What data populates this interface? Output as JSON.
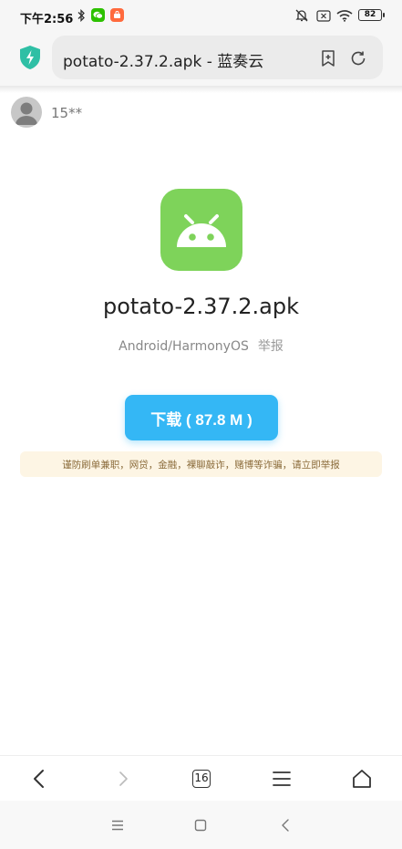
{
  "status_bar": {
    "time": "下午2:56",
    "battery": "82",
    "icons": [
      "bluetooth-icon",
      "wechat-icon",
      "orange-app-icon",
      "mute-icon",
      "sim-x-icon",
      "wifi-icon",
      "battery-icon"
    ]
  },
  "address_bar": {
    "url_text": "potato-2.37.2.apk - 蓝奏云",
    "icons": [
      "shield-icon",
      "bookmark-add-icon",
      "refresh-icon"
    ]
  },
  "user": {
    "name": "15**"
  },
  "app": {
    "file_name": "potato-2.37.2.apk",
    "platform": "Android/HarmonyOS",
    "report_label": "举报",
    "icon": "android-icon"
  },
  "download": {
    "label": "下载 ( 87.8 M )"
  },
  "warning": {
    "text": "谨防刷单兼职，网贷，金融，裸聊敲诈，赌博等诈骗，请立即举报"
  },
  "toolbar": {
    "tabs_count": "16",
    "icons": [
      "back-icon",
      "forward-icon",
      "tabs-icon",
      "menu-icon",
      "home-icon"
    ]
  },
  "system_nav": {
    "icons": [
      "recents-icon",
      "home-square-icon",
      "back-triangle-icon"
    ]
  },
  "colors": {
    "accent": "#34b7f5",
    "app_icon": "#7ed35a",
    "warning_bg": "#fdf5e4",
    "warning_text": "#8a6b3a"
  }
}
